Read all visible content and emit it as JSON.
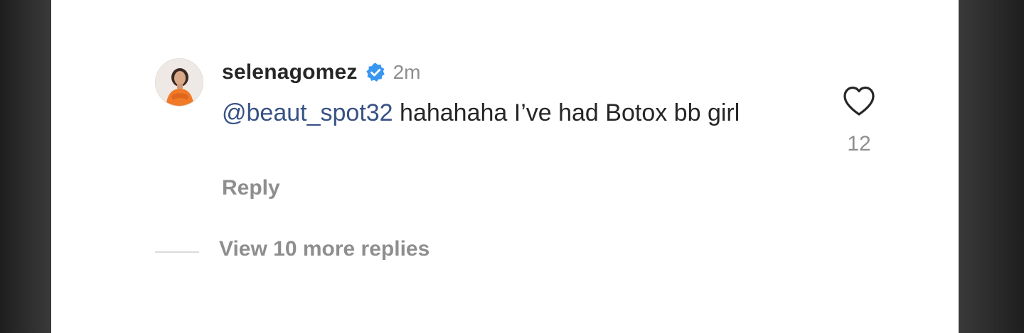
{
  "comment": {
    "username": "selenagomez",
    "verified_icon": "verified-badge-icon",
    "timestamp": "2m",
    "mention": "@beaut_spot32",
    "text": " hahahaha I’ve had Botox bb girl",
    "reply_label": "Reply",
    "like_icon": "heart-icon",
    "like_count": "12"
  },
  "replies": {
    "view_more_label": "View 10 more replies"
  },
  "colors": {
    "verified_blue": "#3897f0",
    "mention_blue": "#385185",
    "muted_gray": "#8e8e8e",
    "text_dark": "#262626"
  }
}
